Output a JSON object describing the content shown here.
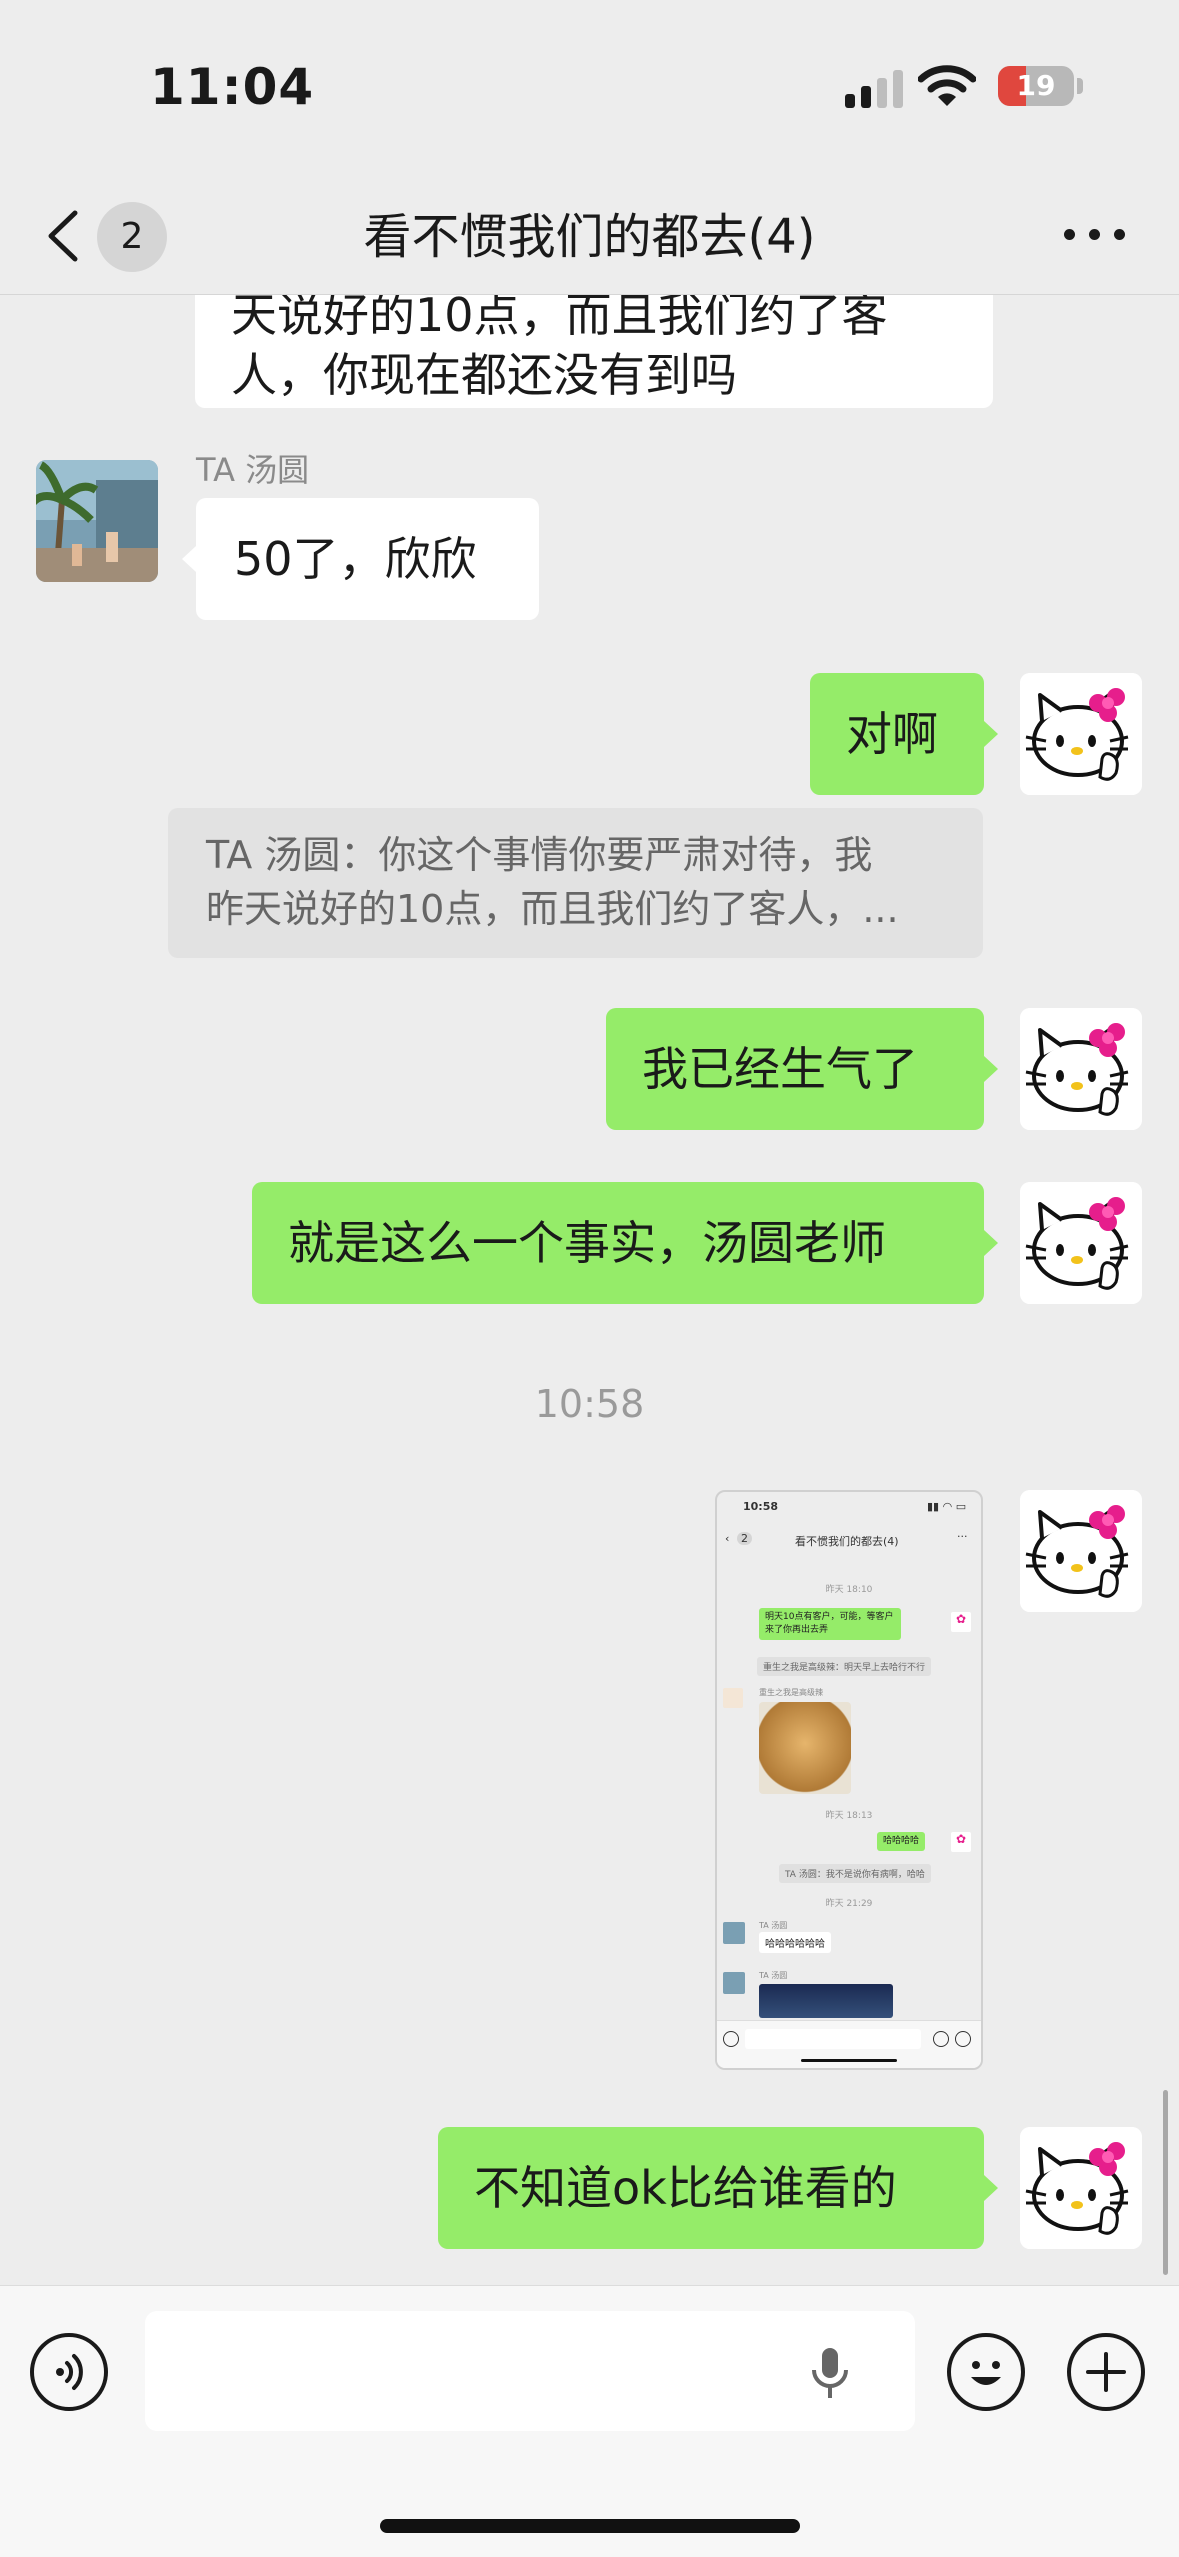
{
  "status_bar": {
    "time": "11:04",
    "battery": "19"
  },
  "nav": {
    "back_badge": "2",
    "title": "看不惯我们的都去(4)"
  },
  "messages": {
    "m0_line1": "天说好的10点，而且我们约了客",
    "m0_line2": "人，你现在都还没有到吗",
    "m1_sender": "TA 汤圆",
    "m1_text": "50了，欣欣",
    "m2_text": "对啊",
    "m2_quote_line1": "TA 汤圆：你这个事情你要严肃对待，我",
    "m2_quote_line2": "昨天说好的10点，而且我们约了客人，...",
    "m3_text": "我已经生气了",
    "m4_text": "就是这么一个事实，汤圆老师",
    "time_sep": "10:58",
    "m6_text": "不知道ok比给谁看的"
  },
  "thumbnail": {
    "time": "10:58",
    "badge": "2",
    "title": "看不惯我们的都去(4)",
    "t1": "昨天 18:10",
    "g1_line1": "明天10点有客户，可能，等客户",
    "g1_line2": "来了你再出去弄",
    "q1": "重生之我是高级辣：明天早上去哈行不行",
    "s1": "重生之我是高级辣",
    "t2": "昨天 18:13",
    "g2": "哈哈哈哈",
    "q2": "TA 汤圆：我不是说你有病啊，哈哈",
    "t3": "昨天 21:29",
    "s2": "TA 汤圆",
    "w1": "哈哈哈哈哈哈",
    "s3": "TA 汤圆"
  },
  "colors": {
    "sent_bubble": "#95ec69",
    "received_bubble": "#ffffff",
    "background": "#ededed"
  },
  "icons": [
    "back-chevron-icon",
    "more-icon",
    "voice-icon",
    "microphone-icon",
    "emoji-icon",
    "plus-icon",
    "hello-kitty-avatar",
    "palm-tree-avatar"
  ]
}
